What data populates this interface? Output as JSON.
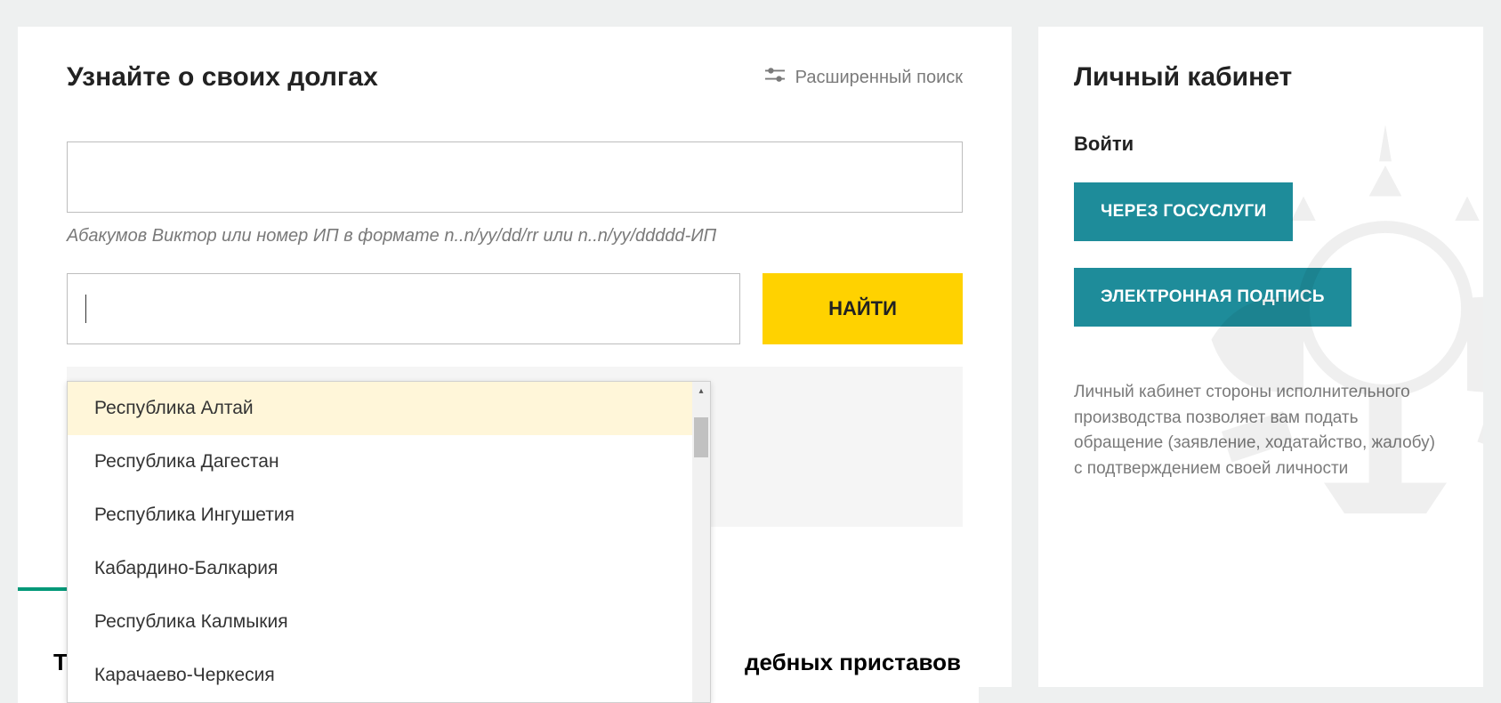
{
  "search": {
    "title": "Узнайте о своих долгах",
    "advanced_label": "Расширенный поиск",
    "hint": "Абакумов Виктор или номер ИП в формате n..n/yy/dd/rr или n..n/yy/ddddd-ИП",
    "find_label": "НАЙТИ",
    "region_value": "",
    "dropdown": {
      "items": [
        "Республика Алтай",
        "Республика Дагестан",
        "Республика Ингушетия",
        "Кабардино-Балкария",
        "Республика Калмыкия",
        "Карачаево-Черкесия"
      ],
      "highlighted_index": 0
    }
  },
  "cabinet": {
    "title": "Личный кабинет",
    "login_label": "Войти",
    "gosuslugi_button": "ЧЕРЕЗ ГОСУСЛУГИ",
    "signature_button": "ЭЛЕКТРОННАЯ ПОДПИСЬ",
    "info": "Личный кабинет стороны исполнительного производства позволяет вам подать обращение (заявление, ходатайство, жалобу) с подтверждением своей личности"
  },
  "bottom": {
    "left_fragment": "Т",
    "right_fragment": "дебных приставов"
  }
}
